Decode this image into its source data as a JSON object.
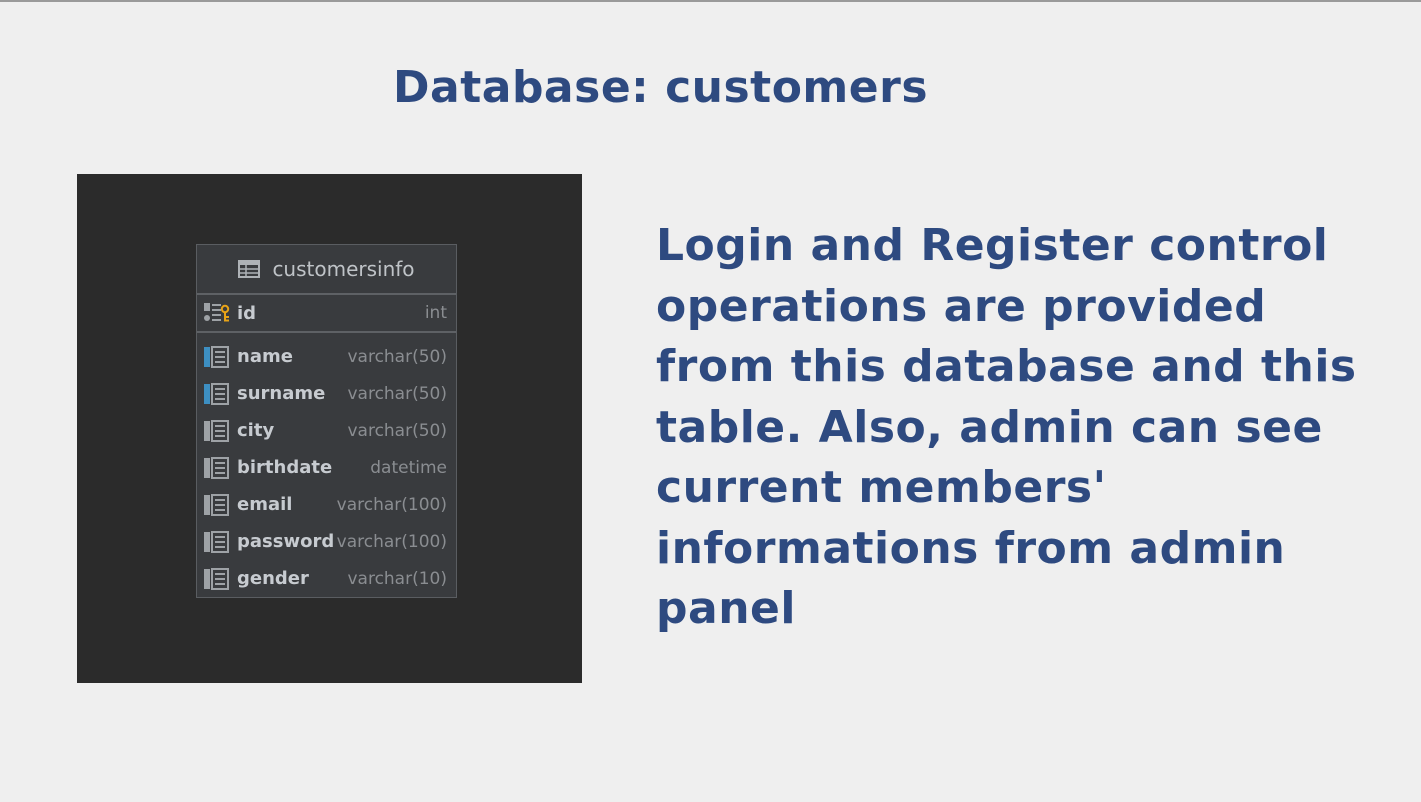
{
  "slide": {
    "title": "Database: customers",
    "description": "Login and Register control operations are provided from this database and this table. Also, admin can see current members' informations from admin panel"
  },
  "table": {
    "name": "customersinfo",
    "primary_key": {
      "name": "id",
      "type": "int",
      "icon": "primary-key-icon"
    },
    "columns": [
      {
        "name": "name",
        "type": "varchar(50)",
        "icon": "column-icon-indexed"
      },
      {
        "name": "surname",
        "type": "varchar(50)",
        "icon": "column-icon-indexed"
      },
      {
        "name": "city",
        "type": "varchar(50)",
        "icon": "column-icon"
      },
      {
        "name": "birthdate",
        "type": "datetime",
        "icon": "column-icon"
      },
      {
        "name": "email",
        "type": "varchar(100)",
        "icon": "column-icon"
      },
      {
        "name": "password",
        "type": "varchar(100)",
        "icon": "column-icon"
      },
      {
        "name": "gender",
        "type": "varchar(10)",
        "icon": "column-icon"
      }
    ]
  },
  "colors": {
    "text_accent": "#2e4a80",
    "background": "#efefef",
    "diagram_background": "#2b2b2b",
    "indexed_marker": "#3d8fc2",
    "key_marker": "#e8a317"
  }
}
